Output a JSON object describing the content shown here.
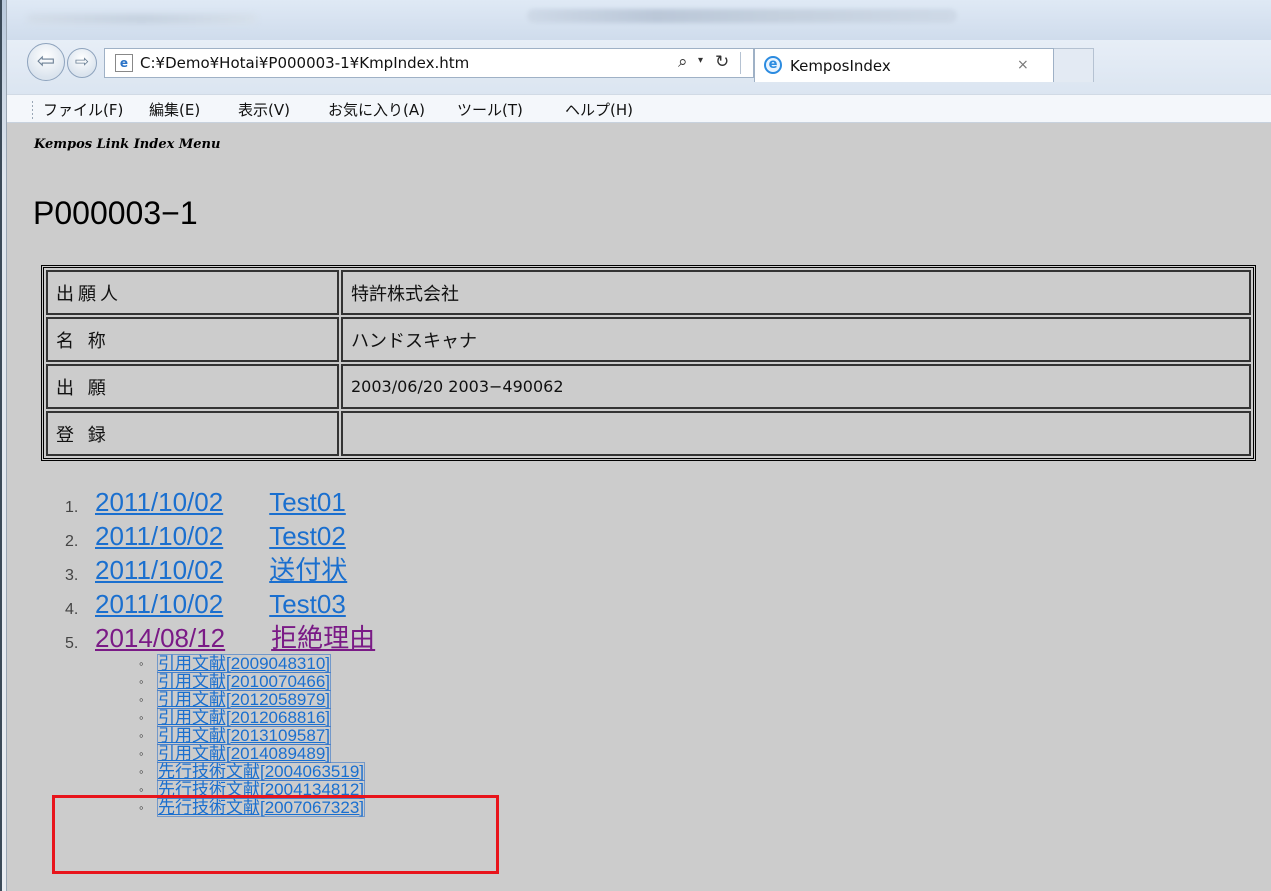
{
  "browser": {
    "address": "C:¥Demo¥Hotai¥P000003-1¥KmpIndex.htm",
    "tab_title": "KemposIndex",
    "tab_close": "×",
    "search_icon": "⌕",
    "dropdown_icon": "▾",
    "refresh_icon": "↻",
    "back_icon": "⇦",
    "forward_icon": "⇨",
    "page_icon": "e",
    "ie_icon": "e"
  },
  "menu": {
    "items": [
      "ファイル(F)",
      "編集(E)",
      "表示(V)",
      "お気に入り(A)",
      "ツール(T)",
      "ヘルプ(H)"
    ]
  },
  "page": {
    "subtitle": "Kempos Link Index Menu",
    "heading": "P000003−1",
    "table": [
      {
        "label": "出願人",
        "value": "特許株式会社"
      },
      {
        "label": "名 称",
        "value": "ハンドスキャナ"
      },
      {
        "label": "出 願",
        "value": "2003/06/20 2003−490062"
      },
      {
        "label": "登 録",
        "value": ""
      }
    ],
    "documents": [
      {
        "num": "1.",
        "date": "2011/10/02",
        "title": "Test01"
      },
      {
        "num": "2.",
        "date": "2011/10/02",
        "title": "Test02"
      },
      {
        "num": "3.",
        "date": "2011/10/02",
        "title": "送付状"
      },
      {
        "num": "4.",
        "date": "2011/10/02",
        "title": "Test03"
      },
      {
        "num": "5.",
        "date": "2014/08/12",
        "title": "拒絶理由"
      }
    ],
    "citations": [
      "引用文献[2009048310]",
      "引用文献[2010070466]",
      "引用文献[2012058979]",
      "引用文献[2012068816]",
      "引用文献[2013109587]",
      "引用文献[2014089489]",
      "先行技術文献[2004063519]",
      "先行技術文献[2004134812]",
      "先行技術文献[2007067323]"
    ],
    "bullet": "◦"
  },
  "colors": {
    "link": "#1a6fcf",
    "visited_link": "#7a1a86",
    "highlight": "#e8141b",
    "page_background": "#cccccc"
  }
}
